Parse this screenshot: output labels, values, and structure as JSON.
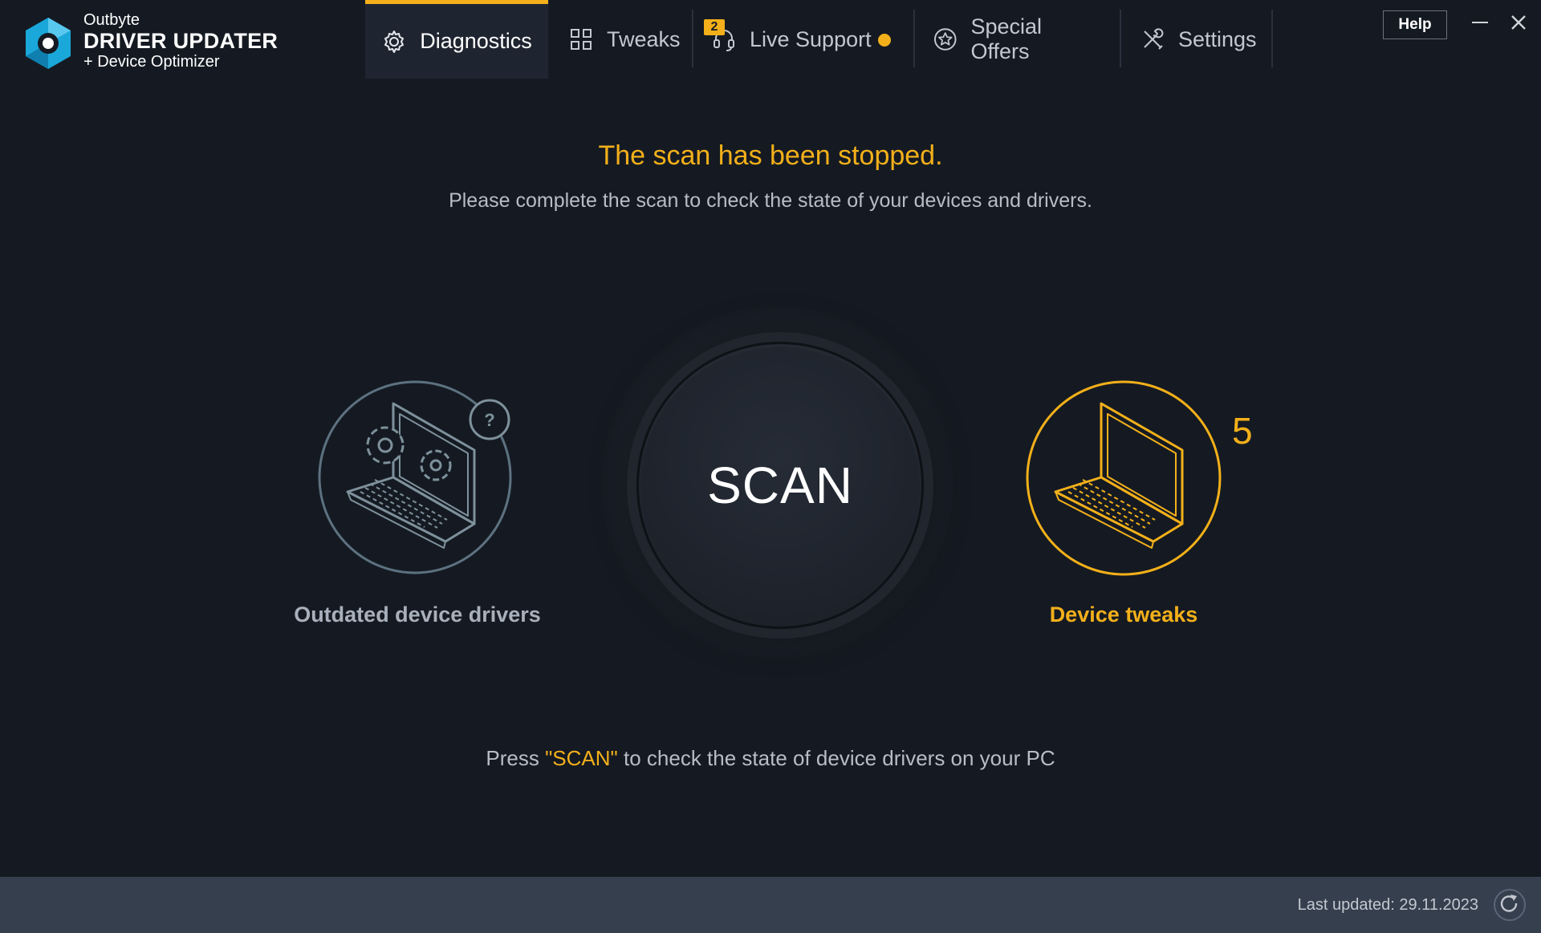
{
  "header": {
    "brand": {
      "line1": "Outbyte",
      "line2": "DRIVER UPDATER",
      "line3": "+ Device Optimizer"
    },
    "tabs": [
      {
        "label": "Diagnostics",
        "icon": "gear-icon",
        "active": true
      },
      {
        "label": "Tweaks",
        "icon": "grid-icon",
        "active": false
      },
      {
        "label": "Live Support",
        "icon": "headset-icon",
        "active": false,
        "badge": "2",
        "has_dot": true
      },
      {
        "label": "Special Offers",
        "icon": "star-badge-icon",
        "active": false
      },
      {
        "label": "Settings",
        "icon": "wrench-screwdriver-icon",
        "active": false
      }
    ],
    "help_label": "Help"
  },
  "main": {
    "status_title": "The scan has been stopped.",
    "status_subtitle": "Please complete the scan to check the state of your devices and drivers.",
    "scan_label": "SCAN",
    "drivers": {
      "label": "Outdated device drivers",
      "indicator": "?"
    },
    "tweaks": {
      "label": "Device tweaks",
      "count": "5"
    },
    "hint": {
      "before": "Press ",
      "highlight": "\"SCAN\"",
      "after": " to check the state of device drivers on your PC"
    }
  },
  "footer": {
    "last_updated": "Last updated: 29.11.2023"
  },
  "colors": {
    "accent": "#f3b01a",
    "background": "#151a22",
    "footer": "#363f4e",
    "muted_circle": "#5d7280"
  }
}
